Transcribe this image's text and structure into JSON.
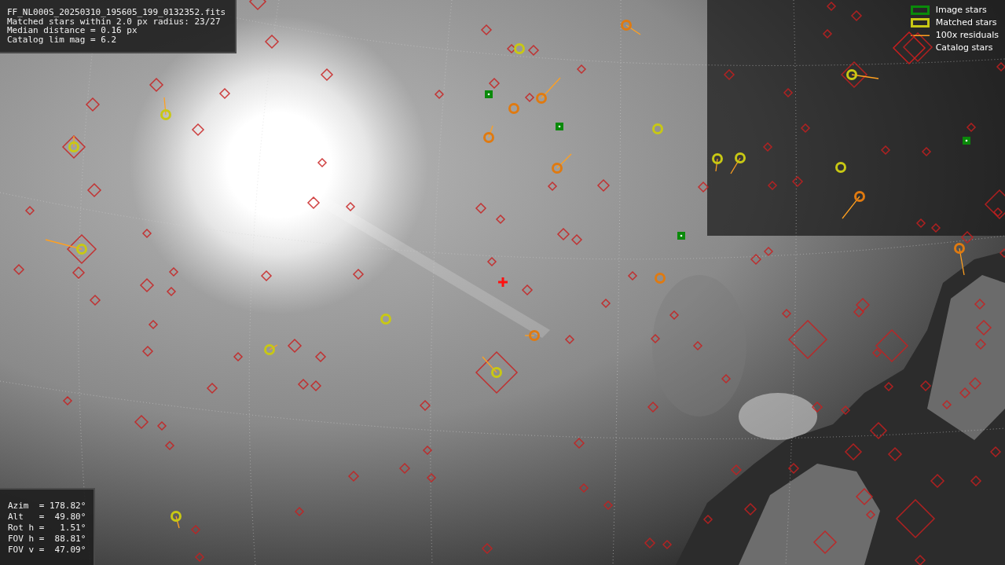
{
  "info_box": {
    "lines": [
      "FF_NL000S_20250310_195605_199_0132352.fits",
      "Matched stars within 2.0 px radius: 23/27",
      "Median distance = 0.16 px",
      "Catalog lim mag = 6.2"
    ]
  },
  "legend": [
    {
      "label": "Image stars",
      "color": "#0a8a0a"
    },
    {
      "kind": "matched",
      "label": "Matched stars",
      "color": "#c8c814"
    },
    {
      "kind": "residual",
      "label": "100x residuals",
      "color": "#ffa020"
    },
    {
      "kind": "catalog",
      "label": "Catalog stars",
      "color": "#c81e1e"
    }
  ],
  "pointing_box": {
    "lines": [
      "Azim  = 178.82°",
      "Alt   =  49.80°",
      "Rot h =   1.51°",
      "FOV h =  88.81°",
      "FOV v =  47.09°"
    ]
  }
}
